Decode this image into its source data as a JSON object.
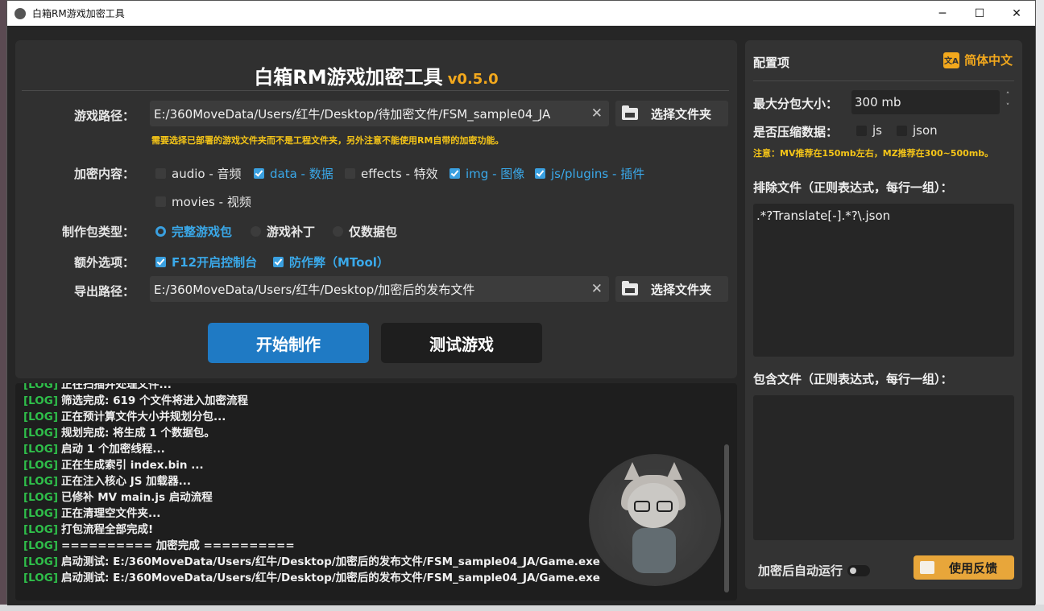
{
  "window": {
    "title": "白箱RM游戏加密工具",
    "minimize": "─",
    "maximize": "☐",
    "close": "✕"
  },
  "header": {
    "title": "白箱RM游戏加密工具",
    "version": "v0.5.0"
  },
  "form": {
    "game_path_label": "游戏路径：",
    "game_path_value": "E:/360MoveData/Users/红牛/Desktop/待加密文件/FSM_sample04_JA",
    "select_folder_label": "选择文件夹",
    "game_path_hint": "需要选择已部署的游戏文件夹而不是工程文件夹，另外注意不能使用RM自带的加密功能。",
    "encrypt_label": "加密内容：",
    "encrypt_options": [
      {
        "label": "audio - 音频",
        "checked": false
      },
      {
        "label": "data - 数据",
        "checked": true
      },
      {
        "label": "effects - 特效",
        "checked": false
      },
      {
        "label": "img - 图像",
        "checked": true
      },
      {
        "label": "js/plugins - 插件",
        "checked": true
      },
      {
        "label": "movies - 视频",
        "checked": false
      }
    ],
    "package_type_label": "制作包类型：",
    "package_types": [
      {
        "label": "完整游戏包",
        "selected": true
      },
      {
        "label": "游戏补丁",
        "selected": false
      },
      {
        "label": "仅数据包",
        "selected": false
      }
    ],
    "extra_label": "额外选项：",
    "extra_options": [
      {
        "label": "F12开启控制台",
        "checked": true
      },
      {
        "label": "防作弊（MTool）",
        "checked": true
      }
    ],
    "export_path_label": "导出路径：",
    "export_path_value": "E:/360MoveData/Users/红牛/Desktop/加密后的发布文件",
    "clear_icon": "✕"
  },
  "actions": {
    "start_label": "开始制作",
    "test_label": "测试游戏"
  },
  "log": {
    "lines": [
      {
        "tag": "[LOG]",
        "text": "正在扫描并处理文件..."
      },
      {
        "tag": "[LOG]",
        "text": "筛选完成: 619 个文件将进入加密流程"
      },
      {
        "tag": "[LOG]",
        "text": "正在预计算文件大小并规划分包..."
      },
      {
        "tag": "[LOG]",
        "text": "规划完成: 将生成 1 个数据包。"
      },
      {
        "tag": "[LOG]",
        "text": "启动 1 个加密线程..."
      },
      {
        "tag": "[LOG]",
        "text": "正在生成索引 index.bin ..."
      },
      {
        "tag": "[LOG]",
        "text": "正在注入核心 JS 加载器..."
      },
      {
        "tag": "[LOG]",
        "text": "已修补 MV main.js 启动流程"
      },
      {
        "tag": "[LOG]",
        "text": "正在清理空文件夹..."
      },
      {
        "tag": "[LOG]",
        "text": "打包流程全部完成!"
      },
      {
        "tag": "[LOG]",
        "text": "========== 加密完成 =========="
      },
      {
        "tag": "[LOG]",
        "text": "启动测试:   E:/360MoveData/Users/红牛/Desktop/加密后的发布文件/FSM_sample04_JA/Game.exe"
      },
      {
        "tag": "[LOG]",
        "text": "启动测试:   E:/360MoveData/Users/红牛/Desktop/加密后的发布文件/FSM_sample04_JA/Game.exe"
      }
    ]
  },
  "config": {
    "title": "配置项",
    "language_label": "简体中文",
    "language_icon": "文A",
    "max_size_label": "最大分包大小：",
    "max_size_value": "300 mb",
    "spin_up": "˄",
    "spin_down": "˅",
    "compress_label": "是否压缩数据：",
    "compress_js": "js",
    "compress_json": "json",
    "note": "注意：MV推荐在150mb左右，MZ推荐在300~500mb。",
    "exclude_label": "排除文件（正则表达式，每行一组）：",
    "exclude_value": ".*?Translate[-].*?\\.json",
    "include_label": "包含文件（正则表达式，每行一组）：",
    "include_value": "",
    "auto_run_label": "加密后自动运行",
    "feedback_label": "使用反馈"
  },
  "colors": {
    "accent_blue": "#1f7ac4",
    "accent_orange": "#f2a81d",
    "log_tag_green": "#2fbf4a",
    "warning_yellow": "#f5c518"
  }
}
